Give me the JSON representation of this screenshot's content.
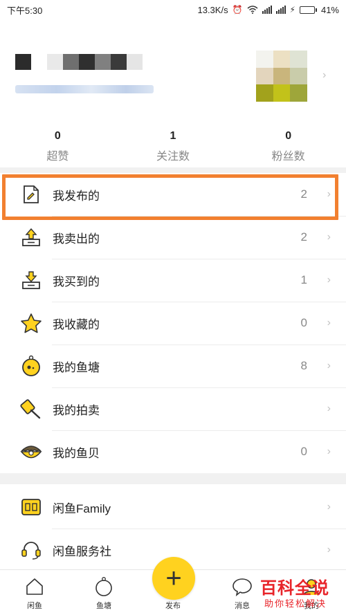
{
  "status_bar": {
    "time": "下午5:30",
    "network_speed": "13.3K/s",
    "battery": "41%",
    "battery_level": 0.41
  },
  "profile": {
    "name_pixel_colors": [
      "#2b2b2b",
      "#ffffff",
      "#e9e9e9",
      "#6f6f6f",
      "#2f2f2f",
      "#808080",
      "#3a3a3a",
      "#e5e5e5"
    ],
    "avatar_pixel_colors": [
      "#f3f3ee",
      "#ece0c3",
      "#dfe3d4",
      "#e3d5bd",
      "#c9b57c",
      "#c9ccaa",
      "#a2a21c",
      "#c2c21a",
      "#9ea63a"
    ]
  },
  "stats": [
    {
      "value": "0",
      "label": "超赞"
    },
    {
      "value": "1",
      "label": "关注数"
    },
    {
      "value": "0",
      "label": "粉丝数"
    }
  ],
  "menu": [
    {
      "label": "我发布的",
      "count": "2",
      "icon": "published-doc-icon"
    },
    {
      "label": "我卖出的",
      "count": "2",
      "icon": "sold-box-icon"
    },
    {
      "label": "我买到的",
      "count": "1",
      "icon": "bought-box-icon"
    },
    {
      "label": "我收藏的",
      "count": "0",
      "icon": "star-icon"
    },
    {
      "label": "我的鱼塘",
      "count": "8",
      "icon": "fishpond-icon"
    },
    {
      "label": "我的拍卖",
      "count": "",
      "icon": "auction-hammer-icon"
    },
    {
      "label": "我的鱼贝",
      "count": "0",
      "icon": "shell-icon"
    }
  ],
  "menu2": [
    {
      "label": "闲鱼Family",
      "icon": "family-icon"
    },
    {
      "label": "闲鱼服务社",
      "icon": "headset-icon"
    }
  ],
  "tabbar": {
    "tabs": [
      "闲鱼",
      "鱼塘",
      "发布",
      "消息",
      "我的"
    ],
    "publish_glyph": "+"
  },
  "watermark": {
    "title": "百科全说",
    "subtitle": "助你轻松解决"
  },
  "colors": {
    "accent_yellow": "#ffd21f",
    "highlight_orange": "#f28030",
    "watermark_red": "#e8242a"
  }
}
